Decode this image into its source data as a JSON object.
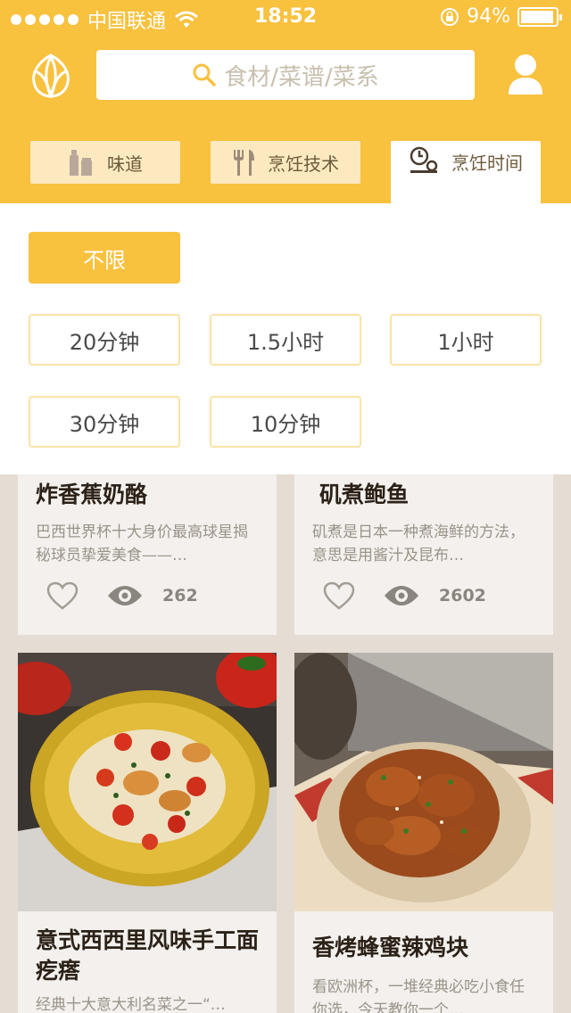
{
  "status_bar": {
    "carrier": "中国联通",
    "time": "18:52",
    "battery": "94%",
    "battery_level": 0.94
  },
  "header": {
    "search_placeholder": "食材/菜谱/菜系",
    "logo_icon": "tulip-logo-icon",
    "user_icon": "user-icon",
    "colors": {
      "brand": "#f8c13e",
      "tab_bg": "#fde9c0"
    }
  },
  "tabs": [
    {
      "label": "味道",
      "icon": "bottles-icon",
      "active": false
    },
    {
      "label": "烹饪技术",
      "icon": "utensils-icon",
      "active": false
    },
    {
      "label": "烹饪时间",
      "icon": "timer-icon",
      "active": true
    }
  ],
  "filters": {
    "selected": "不限",
    "options": [
      "不限",
      "20分钟",
      "1.5小时",
      "1小时",
      "30分钟",
      "10分钟"
    ]
  },
  "recipes": [
    {
      "title": "炸香蕉奶酪",
      "desc": "巴西世界杯十大身价最高球星揭秘球员挚爱美食——…",
      "views": "262"
    },
    {
      "title": "矶煮鲍鱼",
      "desc": "矶煮是日本一种煮海鲜的方法，意思是用酱汁及昆布…",
      "views": "2602"
    },
    {
      "title": "意式西西里风味手工面疙瘩",
      "desc": "经典十大意大利名菜之一“…"
    },
    {
      "title": "香烤蜂蜜辣鸡块",
      "desc": "看欧洲杯，一堆经典必吃小食任你选，今天教你一个…"
    }
  ]
}
